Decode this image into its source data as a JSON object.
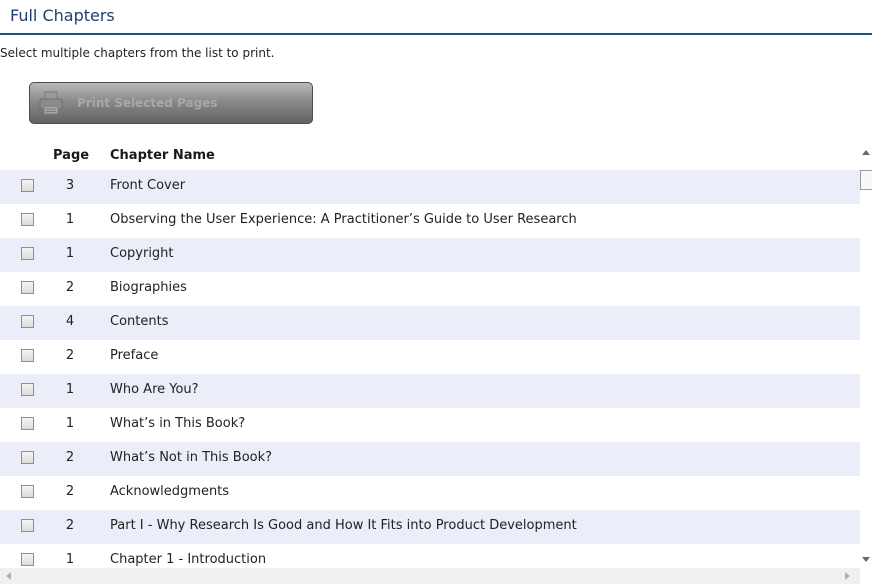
{
  "section": {
    "title": "Full Chapters",
    "instructions": "Select multiple chapters from the list to print."
  },
  "print_button": {
    "label": "Print Selected Pages",
    "icon": "printer-icon",
    "enabled": false
  },
  "chapter_list": {
    "headers": {
      "page": "Page",
      "name": "Chapter Name"
    },
    "rows": [
      {
        "page": "3",
        "name": "Front Cover"
      },
      {
        "page": "1",
        "name": "Observing the User Experience: A Practitioner’s Guide to User Research"
      },
      {
        "page": "1",
        "name": "Copyright"
      },
      {
        "page": "2",
        "name": "Biographies"
      },
      {
        "page": "4",
        "name": "Contents"
      },
      {
        "page": "2",
        "name": "Preface"
      },
      {
        "page": "1",
        "name": "Who Are You?"
      },
      {
        "page": "1",
        "name": "What’s in This Book?"
      },
      {
        "page": "2",
        "name": "What’s Not in This Book?"
      },
      {
        "page": "2",
        "name": "Acknowledgments"
      },
      {
        "page": "2",
        "name": "Part I - Why Research Is Good and How It Fits into Product Development"
      },
      {
        "page": "1",
        "name": "Chapter 1 - Introduction"
      }
    ]
  },
  "colors": {
    "title": "#1f3f6e",
    "rule": "#1f4e8c",
    "row_alt": "#ebedf8",
    "button_dark": "#626262"
  }
}
